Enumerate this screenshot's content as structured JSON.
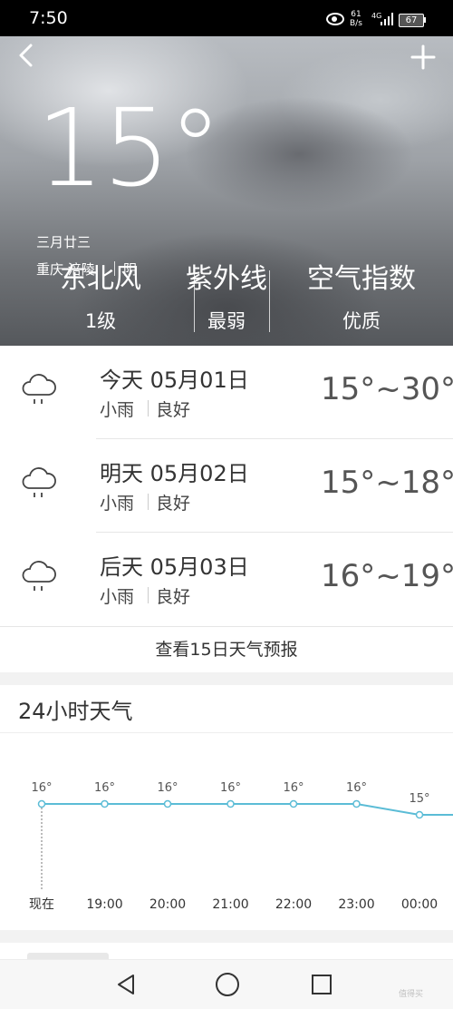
{
  "status_bar": {
    "time": "7:50",
    "net_speed_value": "61",
    "net_speed_unit": "B/s",
    "network_type": "4G",
    "battery": "67"
  },
  "header": {
    "temperature": "15°",
    "lunar_date": "三月廿三",
    "location": "重庆 涪陵",
    "weather": "阴",
    "stats": [
      {
        "title": "东北风",
        "value": "1级"
      },
      {
        "title": "紫外线",
        "value": "最弱"
      },
      {
        "title": "空气指数",
        "value": "优质"
      }
    ]
  },
  "forecast": [
    {
      "day": "今天",
      "date": "05月01日",
      "condition": "小雨",
      "quality": "良好",
      "range": "15°~30°",
      "icon": "cloud-rain-icon"
    },
    {
      "day": "明天",
      "date": "05月02日",
      "condition": "小雨",
      "quality": "良好",
      "range": "15°~18°",
      "icon": "cloud-rain-icon"
    },
    {
      "day": "后天",
      "date": "05月03日",
      "condition": "小雨",
      "quality": "良好",
      "range": "16°~19°",
      "icon": "cloud-rain-icon"
    }
  ],
  "forecast15_link": "查看15日天气预报",
  "hourly_title": "24小时天气",
  "chart_data": {
    "type": "line",
    "categories": [
      "现在",
      "19:00",
      "20:00",
      "21:00",
      "22:00",
      "23:00",
      "00:00"
    ],
    "values": [
      16,
      16,
      16,
      16,
      16,
      16,
      15
    ],
    "value_labels": [
      "16°",
      "16°",
      "16°",
      "16°",
      "16°",
      "16°",
      "15°"
    ],
    "color": "#5bbcd6",
    "xlabel": "",
    "ylabel": "",
    "grid": false
  },
  "colors": {
    "line": "#5bbcd6",
    "status_bar": "#000000",
    "section_gap": "#f2f2f2"
  },
  "watermark": "值得买"
}
